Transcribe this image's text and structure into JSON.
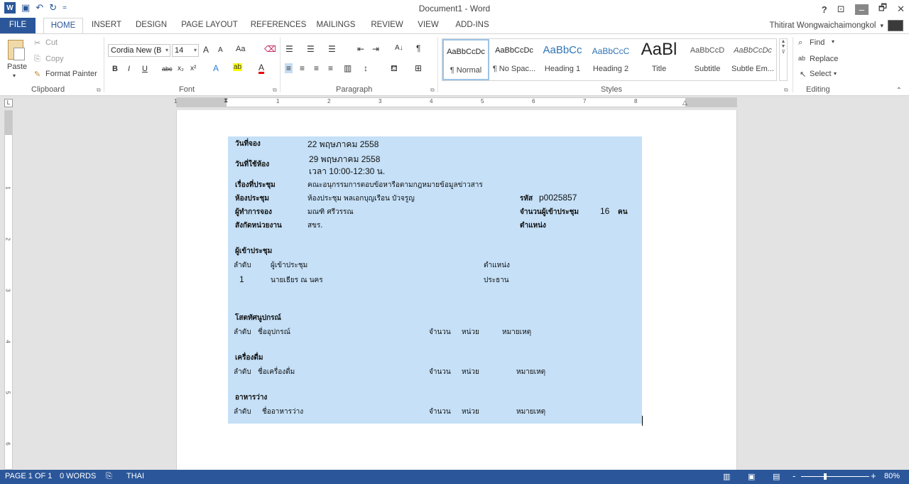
{
  "window": {
    "title": "Document1 - Word",
    "help": "?",
    "ribbon_display": "⊡",
    "minimize": "–",
    "restore": "🗗",
    "close": "✕"
  },
  "qat": {
    "app_icon": "W",
    "save_icon": "save-icon",
    "undo": "↶",
    "redo": "↻",
    "customize": "="
  },
  "tabs": [
    "FILE",
    "HOME",
    "INSERT",
    "DESIGN",
    "PAGE LAYOUT",
    "REFERENCES",
    "MAILINGS",
    "REVIEW",
    "VIEW",
    "ADD-INS"
  ],
  "active_tab": "HOME",
  "account": {
    "user": "Thitirat Wongwaichaimongkol",
    "dropdown": "▾"
  },
  "clipboard": {
    "paste": "Paste",
    "cut": "Cut",
    "copy": "Copy",
    "format_painter": "Format Painter",
    "label": "Clipboard"
  },
  "font": {
    "name": "Cordia New (B",
    "size": "14",
    "grow": "A",
    "shrink": "A",
    "case": "Aa",
    "bold": "B",
    "italic": "I",
    "underline": "U",
    "strike": "abc",
    "sub": "x₂",
    "sup": "x²",
    "effects": "A",
    "highlight": "ab",
    "color": "A",
    "label": "Font"
  },
  "paragraph": {
    "label": "Paragraph",
    "show_marks": "¶",
    "sort": "A↓"
  },
  "styles": {
    "label": "Styles",
    "items": [
      {
        "sample": "AaBbCcDc",
        "name": "¶ Normal"
      },
      {
        "sample": "AaBbCcDc",
        "name": "¶ No Spac..."
      },
      {
        "sample": "AaBbCc",
        "name": "Heading 1"
      },
      {
        "sample": "AaBbCcC",
        "name": "Heading 2"
      },
      {
        "sample": "AaBl",
        "name": "Title"
      },
      {
        "sample": "AaBbCcD",
        "name": "Subtitle"
      },
      {
        "sample": "AaBbCcDc",
        "name": "Subtle Em..."
      }
    ]
  },
  "editing": {
    "find": "Find",
    "replace": "Replace",
    "select": "Select",
    "label": "Editing"
  },
  "ruler": {
    "numbers": [
      "1",
      "1",
      "2",
      "3",
      "4",
      "5",
      "6",
      "7",
      "8"
    ],
    "vnumbers": [
      "1",
      "2",
      "3",
      "4",
      "5",
      "6"
    ]
  },
  "document": {
    "booking_date_label": "วันที่จอง",
    "booking_date": "22 พฤษภาคม 2558",
    "use_date_label": "วันที่ใช้ห้อง",
    "use_date": "29 พฤษภาคม 2558",
    "use_time": "เวลา  10:00-12:30 น.",
    "subject_label": "เรื่องที่ประชุม",
    "subject": "คณะอนุกรรมการตอบข้อหารือตามกฎหมายข้อมูลข่าวสาร",
    "room_label": "ห้องประชุม",
    "room": "ห้องประชุม พลเอกบุญเรือน บัวจรูญ",
    "code_label": "รหัส",
    "code": "p0025857",
    "booker_label": "ผู้ทำการจอง",
    "booker": "มณฑิ ศรีวรรณ",
    "attendee_count_label": "จำนวนผู้เข้าประชุม",
    "attendee_count": "16",
    "attendee_unit": "คน",
    "unit_label": "สังกัดหน่วยงาน",
    "unit": "สขร.",
    "position_label": "ตำแหน่ง",
    "attendees_heading": "ผู้เข้าประชุม",
    "attendees_cols": {
      "order": "ลำดับ",
      "name": "ผู้เข้าประชุม",
      "position": "ตำแหน่ง"
    },
    "attendees": [
      {
        "order": "1",
        "name": "นายเธียร ณ นคร",
        "position": "ประธาน"
      }
    ],
    "av_heading": "โสตทัศนูปกรณ์",
    "av_cols": {
      "order": "ลำดับ",
      "name": "ชื่ออุปกรณ์",
      "qty": "จำนวน",
      "unit": "หน่วย",
      "note": "หมายเหตุ"
    },
    "drinks_heading": "เครื่องดื่ม",
    "drinks_cols": {
      "order": "ลำดับ",
      "name": "ชื่อเครื่องดื่ม",
      "qty": "จำนวน",
      "unit": "หน่วย",
      "note": "หมายเหตุ"
    },
    "snacks_heading": "อาหารว่าง",
    "snacks_cols": {
      "order": "ลำดับ",
      "name": "ชื่ออาหารว่าง",
      "qty": "จำนวน",
      "unit": "หน่วย",
      "note": "หมายเหตุ"
    }
  },
  "status": {
    "page": "PAGE 1 OF 1",
    "words": "0 WORDS",
    "language": "THAI",
    "zoom": "80%",
    "zoom_minus": "-",
    "zoom_plus": "+"
  }
}
